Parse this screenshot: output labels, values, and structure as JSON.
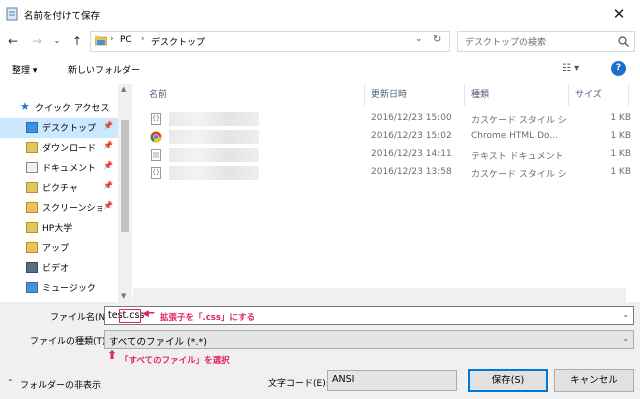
{
  "window": {
    "title": "名前を付けて保存"
  },
  "address": {
    "crumbs": [
      "PC",
      "デスクトップ"
    ],
    "search_placeholder": "デスクトップの検索"
  },
  "toolbar": {
    "organize": "整理 ▾",
    "new_folder": "新しいフォルダー"
  },
  "nav": {
    "items": [
      {
        "label": "クイック アクセス",
        "icon": "star-icon",
        "pinned": false,
        "selected": false
      },
      {
        "label": "デスクトップ",
        "icon": "desktop-folder-icon",
        "pinned": true,
        "selected": true
      },
      {
        "label": "ダウンロード",
        "icon": "download-folder-icon",
        "pinned": true,
        "selected": false
      },
      {
        "label": "ドキュメント",
        "icon": "documents-folder-icon",
        "pinned": true,
        "selected": false
      },
      {
        "label": "ピクチャ",
        "icon": "pictures-folder-icon",
        "pinned": true,
        "selected": false
      },
      {
        "label": "スクリーンショット",
        "icon": "folder-icon",
        "pinned": true,
        "selected": false
      },
      {
        "label": "HP大学",
        "icon": "folder-icon",
        "pinned": false,
        "selected": false
      },
      {
        "label": "アップ",
        "icon": "folder-icon",
        "pinned": false,
        "selected": false
      },
      {
        "label": "ビデオ",
        "icon": "video-folder-icon",
        "pinned": false,
        "selected": false
      },
      {
        "label": "ミュージック",
        "icon": "music-folder-icon",
        "pinned": false,
        "selected": false
      }
    ]
  },
  "list": {
    "columns": [
      "名前",
      "更新日時",
      "種類",
      "サイズ"
    ],
    "rows": [
      {
        "icon": "css-file-icon",
        "date": "2016/12/23 15:00",
        "type": "カスケード スタイル シ...",
        "size": "1 KB"
      },
      {
        "icon": "chrome-html-icon",
        "date": "2016/12/23 15:02",
        "type": "Chrome HTML Do...",
        "size": "1 KB"
      },
      {
        "icon": "text-file-icon",
        "date": "2016/12/23 14:11",
        "type": "テキスト ドキュメント",
        "size": "1 KB"
      },
      {
        "icon": "css-file-icon",
        "date": "2016/12/23 13:58",
        "type": "カスケード スタイル シ...",
        "size": "1 KB"
      }
    ]
  },
  "form": {
    "filename_label": "ファイル名(N):",
    "filename_value": "test.css",
    "filetype_label": "ファイルの種類(T):",
    "filetype_value": "すべてのファイル (*.*)",
    "encoding_label": "文字コード(E):",
    "encoding_value": "ANSI",
    "hide_folders": "フォルダーの非表示",
    "save_label": "保存(S)",
    "cancel_label": "キャンセル"
  },
  "annotations": {
    "ext_note": "拡張子を「.css」にする",
    "type_note": "「すべてのファイル」を選択",
    "color": "#e0245e"
  }
}
